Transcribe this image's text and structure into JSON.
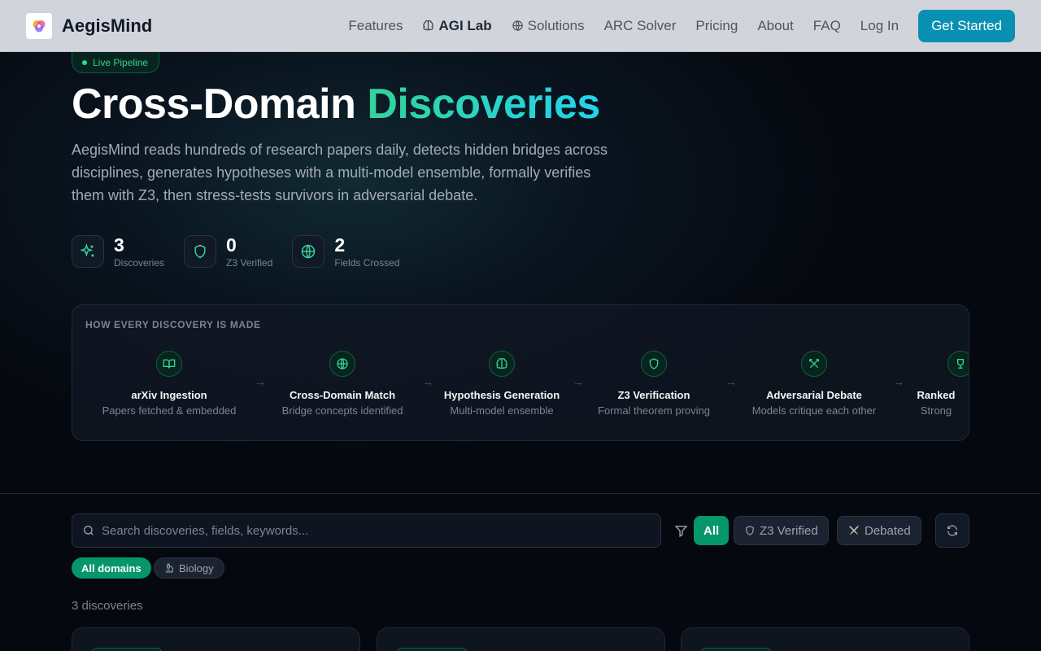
{
  "nav": {
    "brand": "AegisMind",
    "links": [
      {
        "label": "Features"
      },
      {
        "label": "AGI Lab",
        "icon": "brain-icon"
      },
      {
        "label": "Solutions",
        "icon": "globe-icon"
      },
      {
        "label": "ARC Solver"
      },
      {
        "label": "Pricing"
      },
      {
        "label": "About"
      },
      {
        "label": "FAQ"
      }
    ],
    "login": "Log In",
    "cta": "Get Started"
  },
  "hero": {
    "pill": "Live Pipeline",
    "title_plain": "Cross-Domain",
    "title_accent": "Discoveries",
    "description": "AegisMind reads hundreds of research papers daily, detects hidden bridges across disciplines, generates hypotheses with a multi-model ensemble, formally verifies them with Z3, then stress-tests survivors in adversarial debate.",
    "stats": [
      {
        "value": "3",
        "label": "Discoveries",
        "icon": "sparkles-icon"
      },
      {
        "value": "0",
        "label": "Z3 Verified",
        "icon": "shield-icon"
      },
      {
        "value": "2",
        "label": "Fields Crossed",
        "icon": "globe-icon"
      }
    ]
  },
  "pipeline": {
    "title": "HOW EVERY DISCOVERY IS MADE",
    "steps": [
      {
        "name": "arXiv Ingestion",
        "sub": "Papers fetched & embedded",
        "icon": "book-open-icon"
      },
      {
        "name": "Cross-Domain Match",
        "sub": "Bridge concepts identified",
        "icon": "globe-icon"
      },
      {
        "name": "Hypothesis Generation",
        "sub": "Multi-model ensemble",
        "icon": "brain-icon"
      },
      {
        "name": "Z3 Verification",
        "sub": "Formal theorem proving",
        "icon": "shield-icon"
      },
      {
        "name": "Adversarial Debate",
        "sub": "Models critique each other",
        "icon": "swords-icon"
      },
      {
        "name": "Ranked",
        "sub": "Strong",
        "icon": "trophy-icon"
      }
    ]
  },
  "filters": {
    "search_placeholder": "Search discoveries, fields, keywords...",
    "all": "All",
    "z3": "Z3 Verified",
    "debated": "Debated",
    "domain_all": "All domains",
    "domain_bio": "Biology",
    "count_text": "3 discoveries"
  },
  "colors": {
    "accent_green": "#34d399",
    "accent_cyan": "#22d3ee",
    "cta": "#0891b2",
    "active_chip": "#059669"
  }
}
